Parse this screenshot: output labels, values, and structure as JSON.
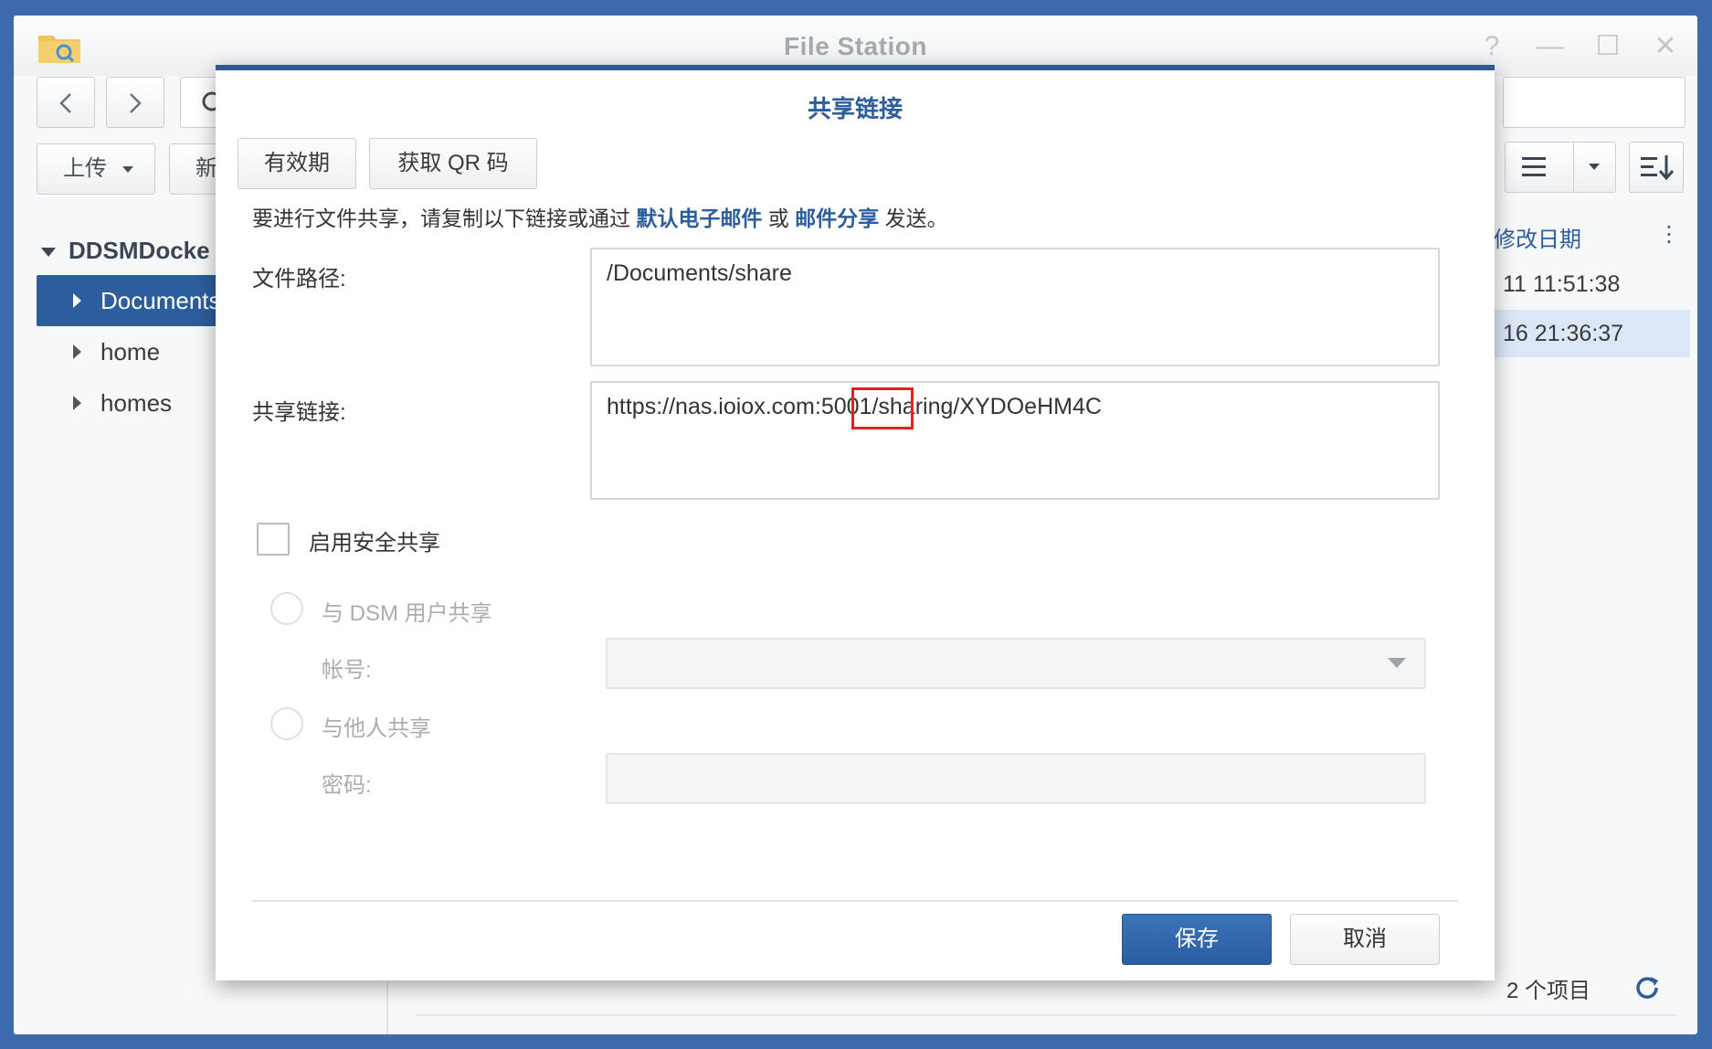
{
  "window": {
    "title": "File Station",
    "controls": [
      "?",
      "—",
      "☐",
      "✕"
    ]
  },
  "toolbar": {
    "upload_label": "上传",
    "new_label_partial": "新",
    "icons": [
      "back-icon",
      "forward-icon",
      "search-icon",
      "list-view-icon",
      "chevron-down-icon",
      "sort-icon"
    ]
  },
  "sidebar": {
    "root_label": "DDSMDocke",
    "items": [
      {
        "label": "Documents",
        "selected": true
      },
      {
        "label": "home",
        "selected": false
      },
      {
        "label": "homes",
        "selected": false
      }
    ]
  },
  "file_list": {
    "column_header": "修改日期",
    "more_icon": "⋮",
    "rows": [
      {
        "modified": "11 11:51:38",
        "selected": false
      },
      {
        "modified": "16 21:36:37",
        "selected": true
      }
    ]
  },
  "status": {
    "item_count": "2 个项目"
  },
  "dialog": {
    "title": "共享链接",
    "tab_buttons": {
      "validity": "有效期",
      "qr": "获取 QR 码"
    },
    "intro": {
      "prefix": "要进行文件共享，请复制以下链接或通过",
      "link1": "默认电子邮件",
      "middle": "或",
      "link2": "邮件分享",
      "suffix": "发送。"
    },
    "file_path": {
      "label": "文件路径:",
      "value": "/Documents/share"
    },
    "share_link": {
      "label": "共享链接:",
      "value": "https://nas.ioiox.com:5001/sharing/XYDOeHM4C",
      "highlighted_part": "5001"
    },
    "secure_share": {
      "label": "启用安全共享",
      "checked": false
    },
    "share_with_dsm": {
      "label": "与 DSM 用户共享",
      "account_label": "帐号:",
      "account_value": ""
    },
    "share_with_others": {
      "label": "与他人共享",
      "password_label": "密码:",
      "password_value": ""
    },
    "buttons": {
      "save": "保存",
      "cancel": "取消"
    }
  },
  "colors": {
    "desktop": "#3d6aaa",
    "accent": "#2c5d9c",
    "highlight_box": "#e2231a"
  }
}
